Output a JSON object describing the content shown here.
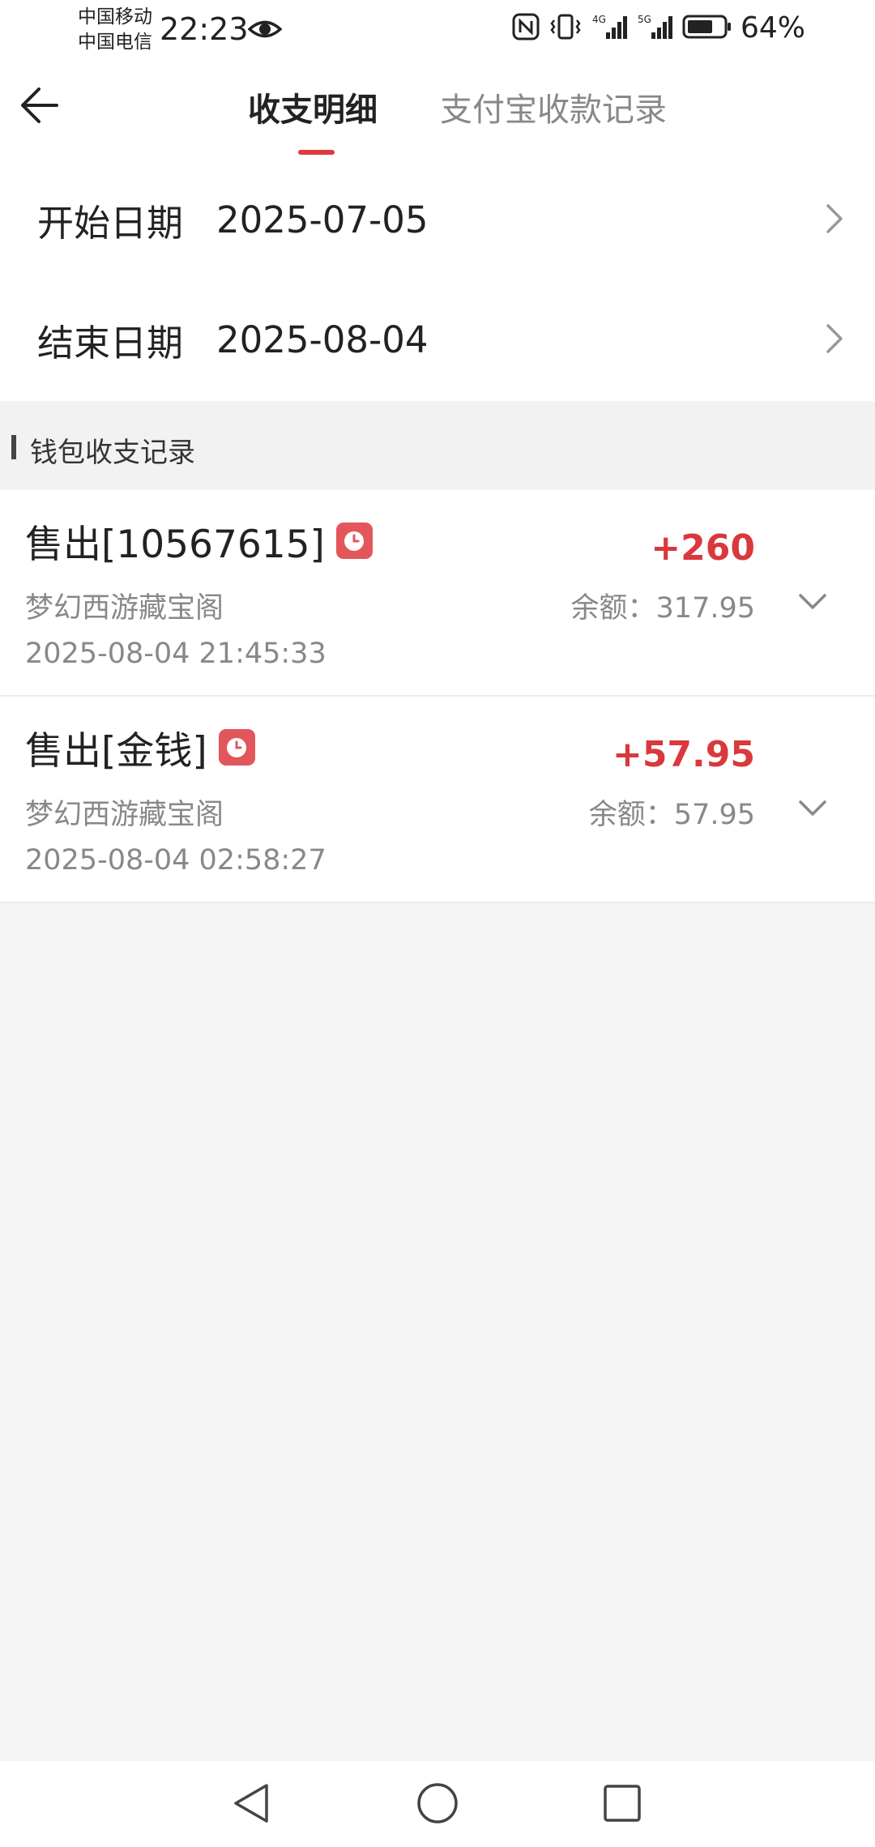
{
  "status_bar": {
    "carrier_1": "中国移动",
    "carrier_2": "中国电信",
    "time": "22:23",
    "battery": "64%"
  },
  "header": {
    "tabs": [
      {
        "label": "收支明细",
        "active": true
      },
      {
        "label": "支付宝收款记录",
        "active": false
      }
    ],
    "accent_color": "#e0393e"
  },
  "date_filter": {
    "start": {
      "label": "开始日期",
      "value": "2025-07-05"
    },
    "end": {
      "label": "结束日期",
      "value": "2025-08-04"
    }
  },
  "section": {
    "title": "钱包收支记录"
  },
  "records": [
    {
      "title": "售出[10567615]",
      "badge_icon": "clock-icon",
      "source": "梦幻西游藏宝阁",
      "time": "2025-08-04 21:45:33",
      "amount": "+260",
      "balance": "余额：317.95"
    },
    {
      "title": "售出[金钱]",
      "badge_icon": "clock-icon",
      "source": "梦幻西游藏宝阁",
      "time": "2025-08-04 02:58:27",
      "amount": "+57.95",
      "balance": "余额：57.95"
    }
  ],
  "nav_bar": {
    "icons": [
      "triangle-back-icon",
      "circle-home-icon",
      "square-recent-icon"
    ]
  }
}
